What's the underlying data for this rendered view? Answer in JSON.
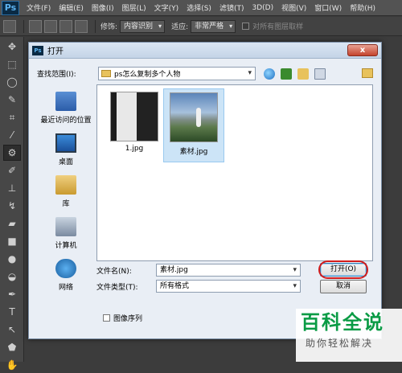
{
  "app": {
    "logo": "Ps"
  },
  "menu": [
    "文件(F)",
    "编辑(E)",
    "图像(I)",
    "图层(L)",
    "文字(Y)",
    "选择(S)",
    "滤镜(T)",
    "3D(D)",
    "视图(V)",
    "窗口(W)",
    "帮助(H)"
  ],
  "options": {
    "feather_label": "修饰:",
    "feather_value": "内容识别",
    "adapt_label": "适应:",
    "adapt_value": "非常严格",
    "sample_all_label": "对所有图层取样"
  },
  "tools": [
    "move-tool",
    "marquee-tool",
    "lasso-tool",
    "quick-select-tool",
    "crop-tool",
    "eyedropper-tool",
    "patch-tool",
    "brush-tool",
    "stamp-tool",
    "history-brush-tool",
    "eraser-tool",
    "gradient-tool",
    "blur-tool",
    "dodge-tool",
    "pen-tool",
    "type-tool",
    "path-select-tool",
    "shape-tool",
    "hand-tool"
  ],
  "dialog": {
    "title": "打开",
    "close": "x",
    "look_in_label": "查找范围(I):",
    "look_in_value": "ps怎么复制多个人物",
    "places": [
      {
        "label": "最近访问的位置",
        "icon": "recent-places-icon"
      },
      {
        "label": "桌面",
        "icon": "desktop-icon"
      },
      {
        "label": "库",
        "icon": "library-icon"
      },
      {
        "label": "计算机",
        "icon": "computer-icon"
      },
      {
        "label": "网络",
        "icon": "network-icon"
      }
    ],
    "files": [
      {
        "name": "1.jpg",
        "selected": false
      },
      {
        "name": "素材.jpg",
        "selected": true
      }
    ],
    "filename_label": "文件名(N):",
    "filename_value": "素材.jpg",
    "filetype_label": "文件类型(T):",
    "filetype_value": "所有格式",
    "open_button": "打开(O)",
    "cancel_button": "取消",
    "image_sequence_label": "图像序列"
  },
  "watermark": {
    "title": "百科全说",
    "subtitle": "助你轻松解决"
  }
}
